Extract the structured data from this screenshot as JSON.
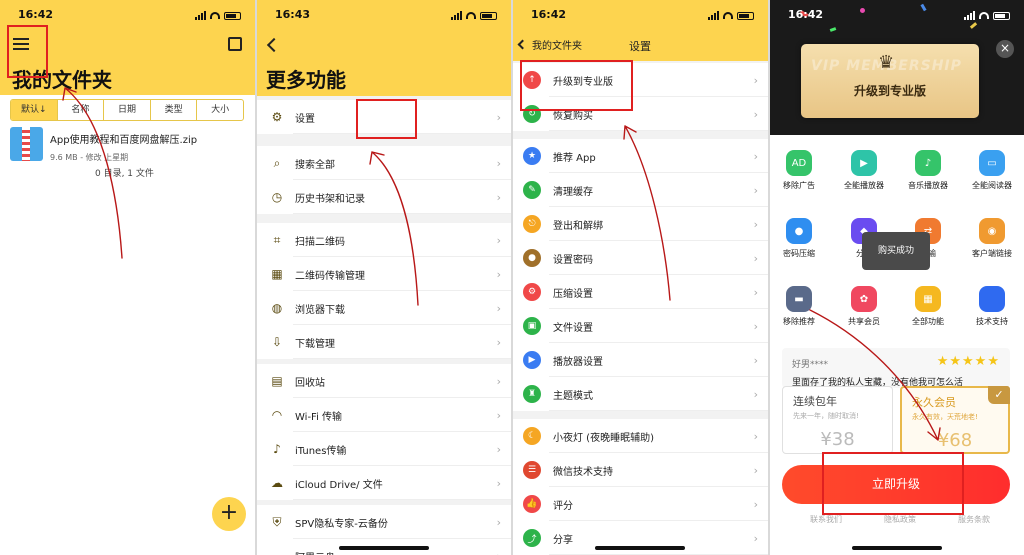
{
  "colors": {
    "brand_yellow": "#fdd44f",
    "annotation_red": "#e02020",
    "upgrade_red": "#ff3b30"
  },
  "panel1": {
    "time": "16:42",
    "title": "我的文件夹",
    "sort_tabs": [
      "默认↓",
      "名称",
      "日期",
      "类型",
      "大小"
    ],
    "file": {
      "name": "App使用教程和百度网盘解压.zip",
      "meta": "9.6 MB - 修改 上星期",
      "summary": "0 目录, 1 文件"
    },
    "fab": "+"
  },
  "panel2": {
    "time": "16:43",
    "title": "更多功能",
    "items": [
      {
        "label": "设置",
        "icon": "gear-icon"
      },
      {
        "label": "搜索全部",
        "icon": "search-icon"
      },
      {
        "label": "历史书架和记录",
        "icon": "clock-icon"
      },
      {
        "label": "扫描二维码",
        "icon": "scan-icon"
      },
      {
        "label": "二维码传输管理",
        "icon": "qrcode-icon"
      },
      {
        "label": "浏览器下载",
        "icon": "planet-icon"
      },
      {
        "label": "下载管理",
        "icon": "download-icon"
      },
      {
        "label": "回收站",
        "icon": "trash-icon"
      },
      {
        "label": "Wi-Fi 传输",
        "icon": "wifi-icon"
      },
      {
        "label": "iTunes传输",
        "icon": "music-icon"
      },
      {
        "label": "iCloud Drive/ 文件",
        "icon": "cloud-icon"
      },
      {
        "label": "SPV隐私专家-云备份",
        "icon": "shield-icon"
      },
      {
        "label": "阿里云盘",
        "icon": "cloud-icon"
      }
    ]
  },
  "panel3": {
    "time": "16:42",
    "back_label": "我的文件夹",
    "title": "设置",
    "items": [
      {
        "label": "升级到专业版",
        "icon": "arrow-up-icon",
        "color": "#f04848"
      },
      {
        "label": "恢复购买",
        "icon": "refresh-icon",
        "color": "#2db34a"
      },
      {
        "label": "推荐 App",
        "icon": "star-icon",
        "color": "#3a7cf2"
      },
      {
        "label": "清理缓存",
        "icon": "broom-icon",
        "color": "#2db34a"
      },
      {
        "label": "登出和解绑",
        "icon": "logout-icon",
        "color": "#f5a623"
      },
      {
        "label": "设置密码",
        "icon": "lock-icon",
        "color": "#a0702a"
      },
      {
        "label": "压缩设置",
        "icon": "gear-icon",
        "color": "#f04848"
      },
      {
        "label": "文件设置",
        "icon": "file-icon",
        "color": "#2db34a"
      },
      {
        "label": "播放器设置",
        "icon": "play-icon",
        "color": "#3a7cf2"
      },
      {
        "label": "主题模式",
        "icon": "shirt-icon",
        "color": "#2db34a"
      },
      {
        "label": "小夜灯 (夜晚睡眠辅助)",
        "icon": "moon-icon",
        "color": "#f5a623"
      },
      {
        "label": "微信技术支持",
        "icon": "chat-icon",
        "color": "#e04830"
      },
      {
        "label": "评分",
        "icon": "thumb-icon",
        "color": "#f04848"
      },
      {
        "label": "分享",
        "icon": "share-icon",
        "color": "#2db34a"
      }
    ]
  },
  "panel4": {
    "time": "16:42",
    "card_title": "升级到专业版",
    "card_watermark": "VIP MEMBERSHIP",
    "close": "×",
    "features": [
      {
        "label": "移除广告",
        "color": "#35c46a",
        "icon": "ad-icon"
      },
      {
        "label": "全能播放器",
        "color": "#2ec4a8",
        "icon": "play-icon"
      },
      {
        "label": "音乐播放器",
        "color": "#35c46a",
        "icon": "music-icon"
      },
      {
        "label": "全能阅读器",
        "color": "#3aa0f0",
        "icon": "book-icon"
      },
      {
        "label": "密码压缩",
        "color": "#2f8ef0",
        "icon": "lock-icon"
      },
      {
        "label": "分卷",
        "color": "#6a4cf0",
        "icon": "layers-icon"
      },
      {
        "label": "传输",
        "color": "#f07a30",
        "icon": "transfer-icon"
      },
      {
        "label": "客户端链接",
        "color": "#f09a30",
        "icon": "rss-icon"
      },
      {
        "label": "移除推荐",
        "color": "#5a6a8a",
        "icon": "card-icon"
      },
      {
        "label": "共享会员",
        "color": "#f04860",
        "icon": "share-icon"
      },
      {
        "label": "全部功能",
        "color": "#f5b820",
        "icon": "grid-icon"
      },
      {
        "label": "技术支持",
        "color": "#2f6af0",
        "icon": "code-icon"
      }
    ],
    "toast": "购买成功",
    "review": {
      "user": "好男****",
      "stars": "★★★★★",
      "text": "里面存了我的私人宝藏，没有他我可怎么活"
    },
    "plans": [
      {
        "name": "连续包年",
        "desc": "先来一年，随时取消!",
        "price": "¥38"
      },
      {
        "name": "永久会员",
        "desc": "永久有效，天荒地老!",
        "price": "¥68",
        "check": "✓"
      }
    ],
    "upgrade_button": "立即升级",
    "footer_links": [
      "联系我们",
      "隐私政策",
      "服务条款"
    ]
  }
}
